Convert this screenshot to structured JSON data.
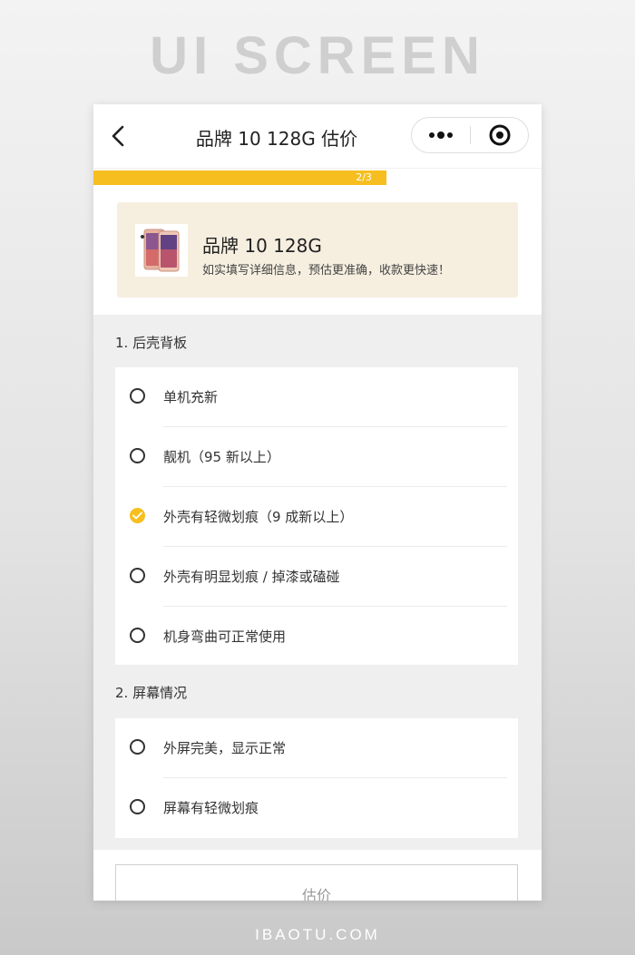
{
  "showcase": {
    "headline": "UI SCREEN",
    "footer_brand": "IBAOTU.COM"
  },
  "navbar": {
    "title": "品牌 10 128G 估价",
    "back_icon": "chevron-left-icon",
    "more_icon": "more-dots-icon",
    "close_icon": "target-close-icon"
  },
  "progress": {
    "text": "2/3",
    "value": 0.667,
    "color": "#f6bf1f"
  },
  "product": {
    "name": "品牌 10 128G",
    "tip": "如实填写详细信息，预估更准确，收款更快速！",
    "card_color": "#f6efe0"
  },
  "sections": [
    {
      "title": "1. 后壳背板",
      "options": [
        {
          "label": "单机充新",
          "checked": false
        },
        {
          "label": "靓机（95 新以上）",
          "checked": false
        },
        {
          "label": "外壳有轻微划痕（9 成新以上）",
          "checked": true
        },
        {
          "label": "外壳有明显划痕 / 掉漆或磕碰",
          "checked": false
        },
        {
          "label": "机身弯曲可正常使用",
          "checked": false
        }
      ]
    },
    {
      "title": "2. 屏幕情况",
      "options": [
        {
          "label": "外屏完美，显示正常",
          "checked": false
        },
        {
          "label": "屏幕有轻微划痕",
          "checked": false
        }
      ]
    }
  ],
  "submit": {
    "label": "估价"
  }
}
